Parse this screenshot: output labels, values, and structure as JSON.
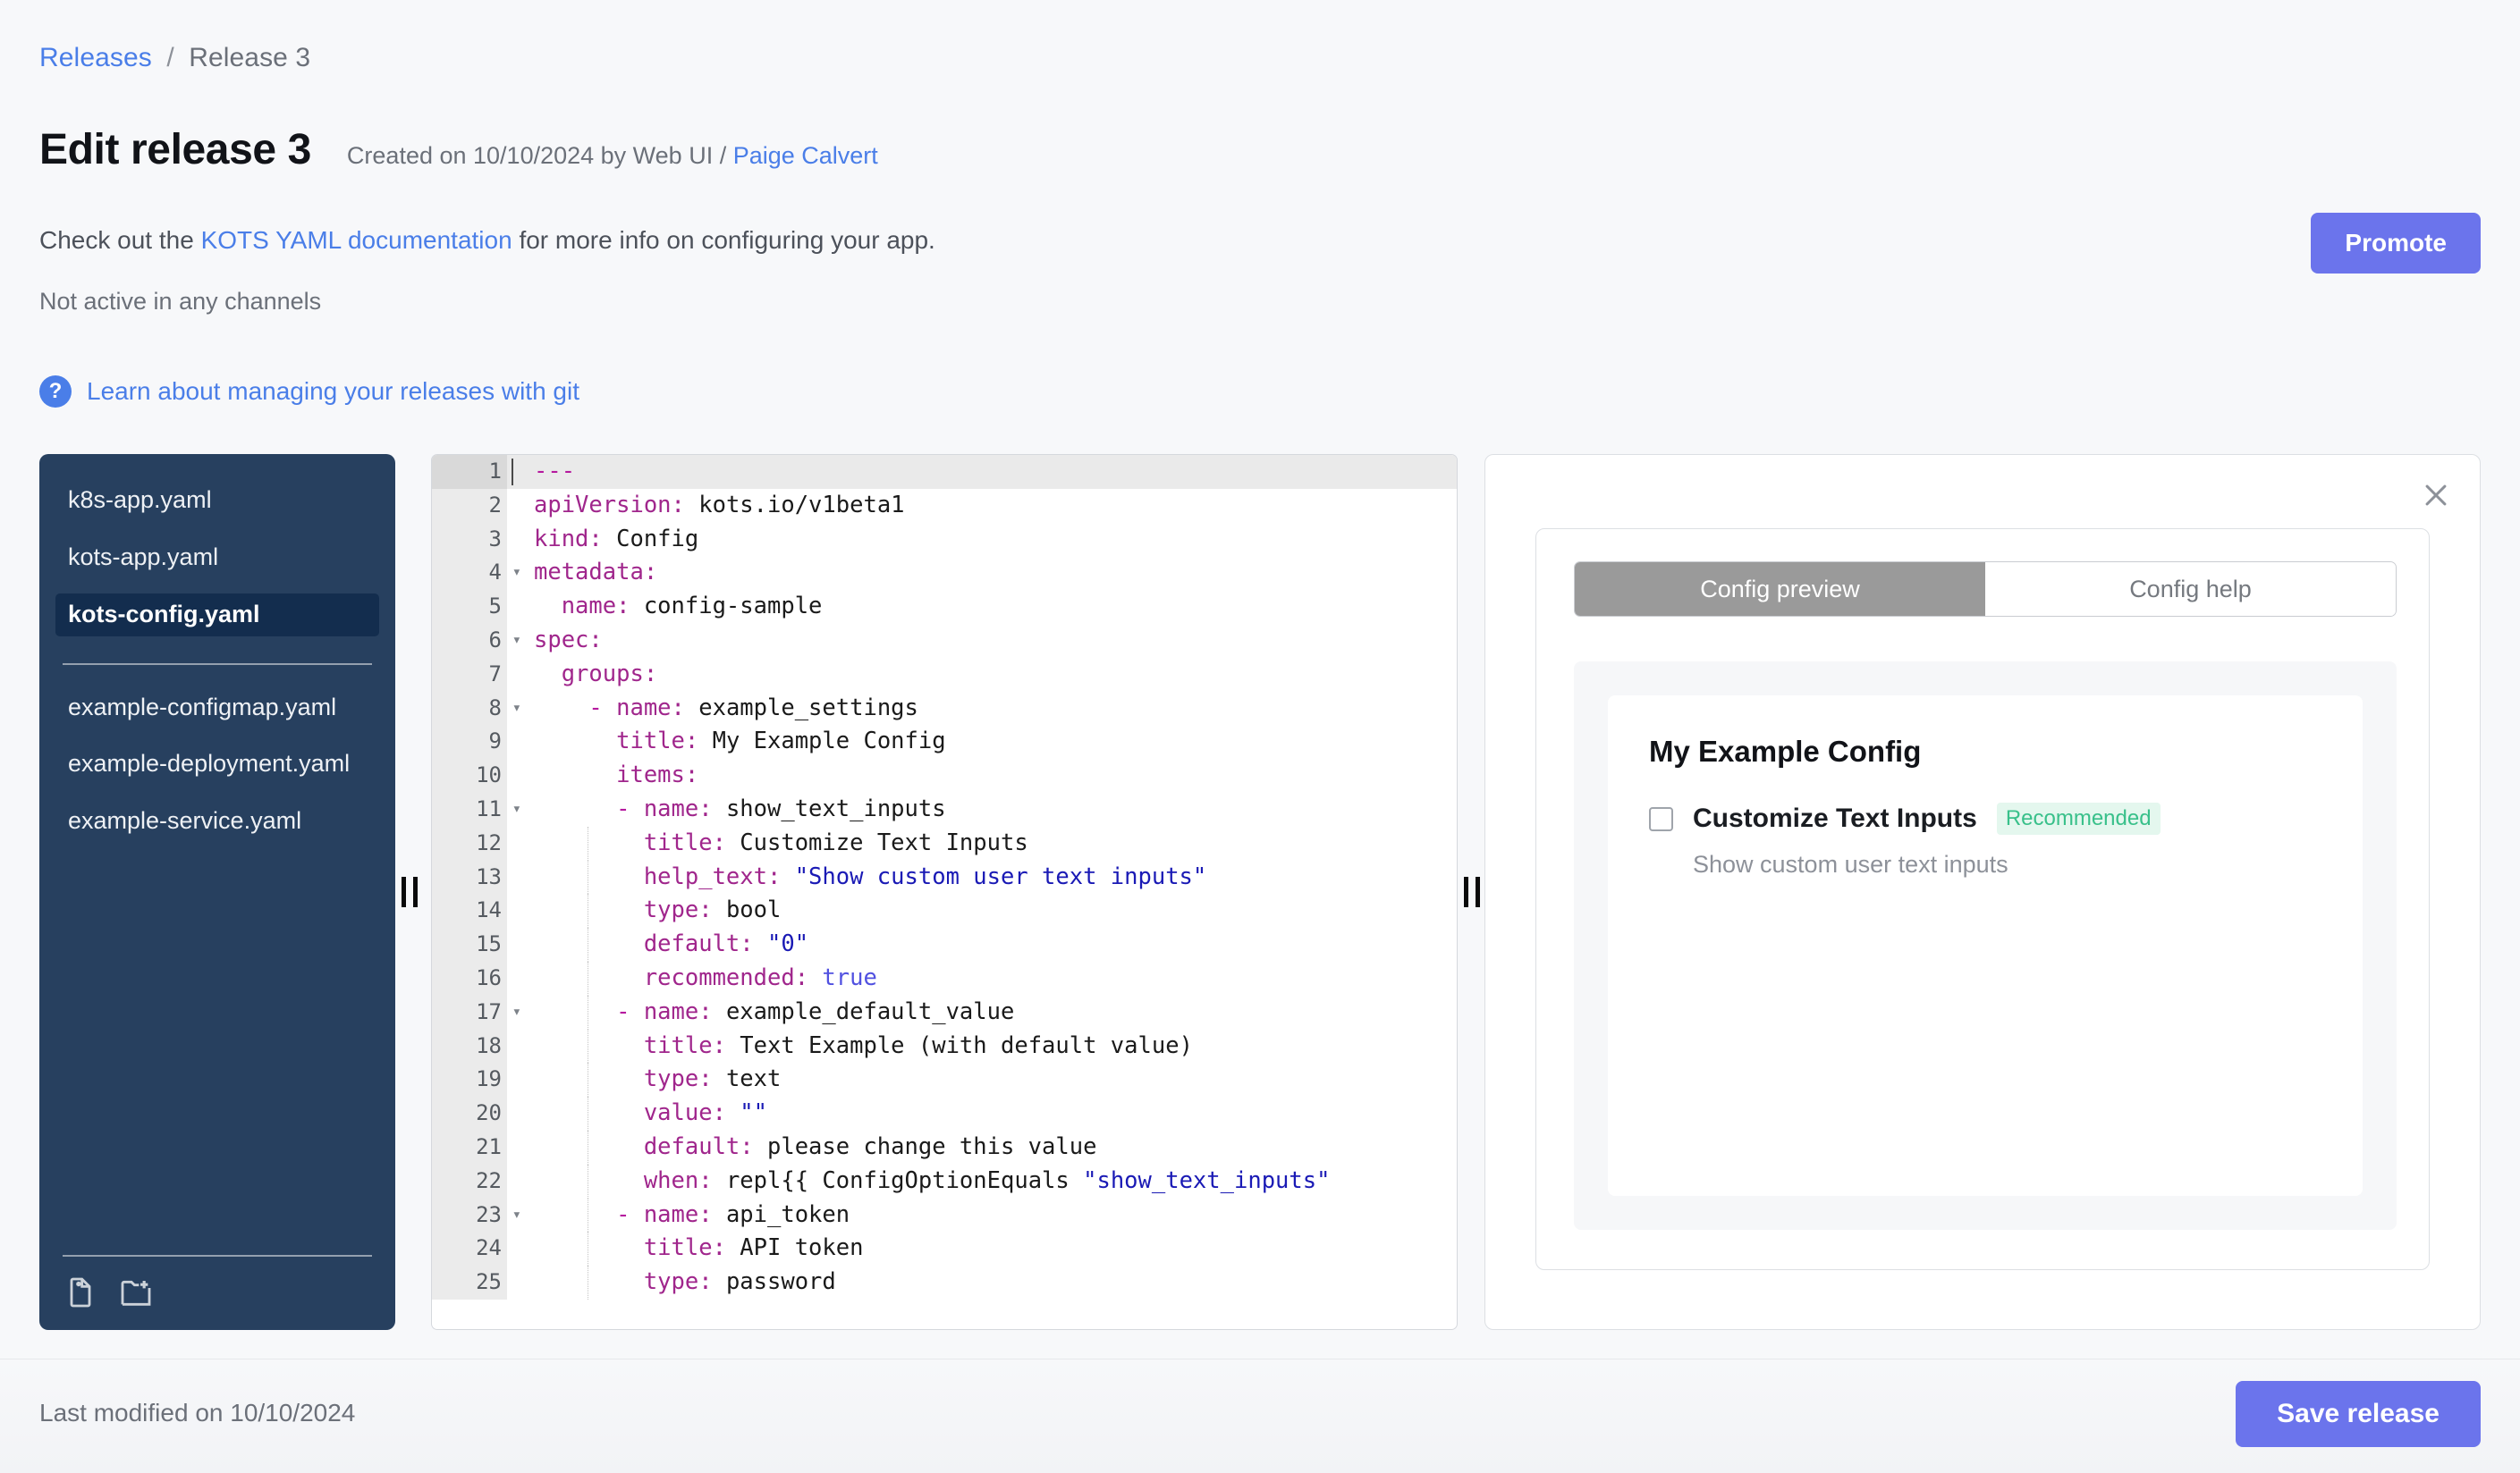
{
  "breadcrumb": {
    "root_label": "Releases",
    "separator": "/",
    "current_label": "Release 3"
  },
  "header": {
    "title": "Edit release 3",
    "created_prefix": "Created on 10/10/2024 by Web UI /",
    "author": "Paige Calvert",
    "subtitle_before": "Check out the ",
    "subtitle_link": "KOTS YAML documentation",
    "subtitle_after": " for more info on configuring your app.",
    "channels_note": "Not active in any channels",
    "promote_label": "Promote"
  },
  "git_row": {
    "help_glyph": "?",
    "link_label": "Learn about managing your releases with git"
  },
  "sidebar": {
    "files": [
      {
        "name": "k8s-app.yaml",
        "selected": false
      },
      {
        "name": "kots-app.yaml",
        "selected": false
      },
      {
        "name": "kots-config.yaml",
        "selected": true
      }
    ],
    "files_secondary": [
      {
        "name": "example-configmap.yaml",
        "selected": false
      },
      {
        "name": "example-deployment.yaml",
        "selected": false
      },
      {
        "name": "example-service.yaml",
        "selected": false
      }
    ],
    "actions": [
      {
        "icon": "new-file-icon",
        "label": "New file"
      },
      {
        "icon": "new-folder-icon",
        "label": "New folder"
      }
    ]
  },
  "editor": {
    "active_line": 1,
    "lines": [
      {
        "n": 1,
        "fold": false,
        "tokens": [
          {
            "t": "---",
            "c": "d"
          }
        ]
      },
      {
        "n": 2,
        "fold": false,
        "tokens": [
          {
            "t": "apiVersion:",
            "c": "k"
          },
          {
            "t": " kots.io/v1beta1",
            "c": "p"
          }
        ]
      },
      {
        "n": 3,
        "fold": false,
        "tokens": [
          {
            "t": "kind:",
            "c": "k"
          },
          {
            "t": " Config",
            "c": "p"
          }
        ]
      },
      {
        "n": 4,
        "fold": true,
        "tokens": [
          {
            "t": "metadata:",
            "c": "k"
          }
        ]
      },
      {
        "n": 5,
        "fold": false,
        "tokens": [
          {
            "t": "  name:",
            "c": "k"
          },
          {
            "t": " config-sample",
            "c": "p"
          }
        ]
      },
      {
        "n": 6,
        "fold": true,
        "tokens": [
          {
            "t": "spec:",
            "c": "k"
          }
        ]
      },
      {
        "n": 7,
        "fold": false,
        "tokens": [
          {
            "t": "  groups:",
            "c": "k"
          }
        ]
      },
      {
        "n": 8,
        "fold": true,
        "tokens": [
          {
            "t": "    - ",
            "c": "d"
          },
          {
            "t": "name:",
            "c": "k"
          },
          {
            "t": " example_settings",
            "c": "p"
          }
        ]
      },
      {
        "n": 9,
        "fold": false,
        "tokens": [
          {
            "t": "      title:",
            "c": "k"
          },
          {
            "t": " My Example Config",
            "c": "p"
          }
        ]
      },
      {
        "n": 10,
        "fold": false,
        "tokens": [
          {
            "t": "      items:",
            "c": "k"
          }
        ]
      },
      {
        "n": 11,
        "fold": true,
        "tokens": [
          {
            "t": "      - ",
            "c": "d"
          },
          {
            "t": "name:",
            "c": "k"
          },
          {
            "t": " show_text_inputs",
            "c": "p"
          }
        ]
      },
      {
        "n": 12,
        "fold": false,
        "tokens": [
          {
            "t": "        title:",
            "c": "k"
          },
          {
            "t": " Customize Text Inputs",
            "c": "p"
          }
        ]
      },
      {
        "n": 13,
        "fold": false,
        "tokens": [
          {
            "t": "        help_text:",
            "c": "k"
          },
          {
            "t": " \"Show custom user text inputs\"",
            "c": "s"
          }
        ]
      },
      {
        "n": 14,
        "fold": false,
        "tokens": [
          {
            "t": "        type:",
            "c": "k"
          },
          {
            "t": " bool",
            "c": "p"
          }
        ]
      },
      {
        "n": 15,
        "fold": false,
        "tokens": [
          {
            "t": "        default:",
            "c": "k"
          },
          {
            "t": " \"0\"",
            "c": "s"
          }
        ]
      },
      {
        "n": 16,
        "fold": false,
        "tokens": [
          {
            "t": "        recommended:",
            "c": "k"
          },
          {
            "t": " true",
            "c": "b"
          }
        ]
      },
      {
        "n": 17,
        "fold": true,
        "tokens": [
          {
            "t": "      - ",
            "c": "d"
          },
          {
            "t": "name:",
            "c": "k"
          },
          {
            "t": " example_default_value",
            "c": "p"
          }
        ]
      },
      {
        "n": 18,
        "fold": false,
        "tokens": [
          {
            "t": "        title:",
            "c": "k"
          },
          {
            "t": " Text Example (with default value)",
            "c": "p"
          }
        ]
      },
      {
        "n": 19,
        "fold": false,
        "tokens": [
          {
            "t": "        type:",
            "c": "k"
          },
          {
            "t": " text",
            "c": "p"
          }
        ]
      },
      {
        "n": 20,
        "fold": false,
        "tokens": [
          {
            "t": "        value:",
            "c": "k"
          },
          {
            "t": " \"\"",
            "c": "s"
          }
        ]
      },
      {
        "n": 21,
        "fold": false,
        "tokens": [
          {
            "t": "        default:",
            "c": "k"
          },
          {
            "t": " please change this value",
            "c": "p"
          }
        ]
      },
      {
        "n": 22,
        "fold": false,
        "tokens": [
          {
            "t": "        when:",
            "c": "k"
          },
          {
            "t": " repl{{ ConfigOptionEquals ",
            "c": "p"
          },
          {
            "t": "\"show_text_inputs\"",
            "c": "s"
          }
        ]
      },
      {
        "n": 23,
        "fold": true,
        "tokens": [
          {
            "t": "      - ",
            "c": "d"
          },
          {
            "t": "name:",
            "c": "k"
          },
          {
            "t": " api_token",
            "c": "p"
          }
        ]
      },
      {
        "n": 24,
        "fold": false,
        "tokens": [
          {
            "t": "        title:",
            "c": "k"
          },
          {
            "t": " API token",
            "c": "p"
          }
        ]
      },
      {
        "n": 25,
        "fold": false,
        "tokens": [
          {
            "t": "        type:",
            "c": "k"
          },
          {
            "t": " password",
            "c": "p"
          }
        ]
      }
    ]
  },
  "preview": {
    "close_glyph": "close-icon",
    "tabs": [
      {
        "label": "Config preview",
        "active": true
      },
      {
        "label": "Config help",
        "active": false
      }
    ],
    "config": {
      "title": "My Example Config",
      "items": [
        {
          "label": "Customize Text Inputs",
          "badge": "Recommended",
          "help": "Show custom user text inputs",
          "checked": false
        }
      ]
    }
  },
  "footer": {
    "last_modified": "Last modified on 10/10/2024",
    "save_label": "Save release"
  },
  "colors": {
    "accent_blue": "#4a7ee8",
    "primary_purple": "#6b74ec",
    "sidebar_navy": "#27405f",
    "sidebar_selected": "#132d4e",
    "badge_green": "#38c08a",
    "badge_green_bg": "#e4f7ee"
  }
}
